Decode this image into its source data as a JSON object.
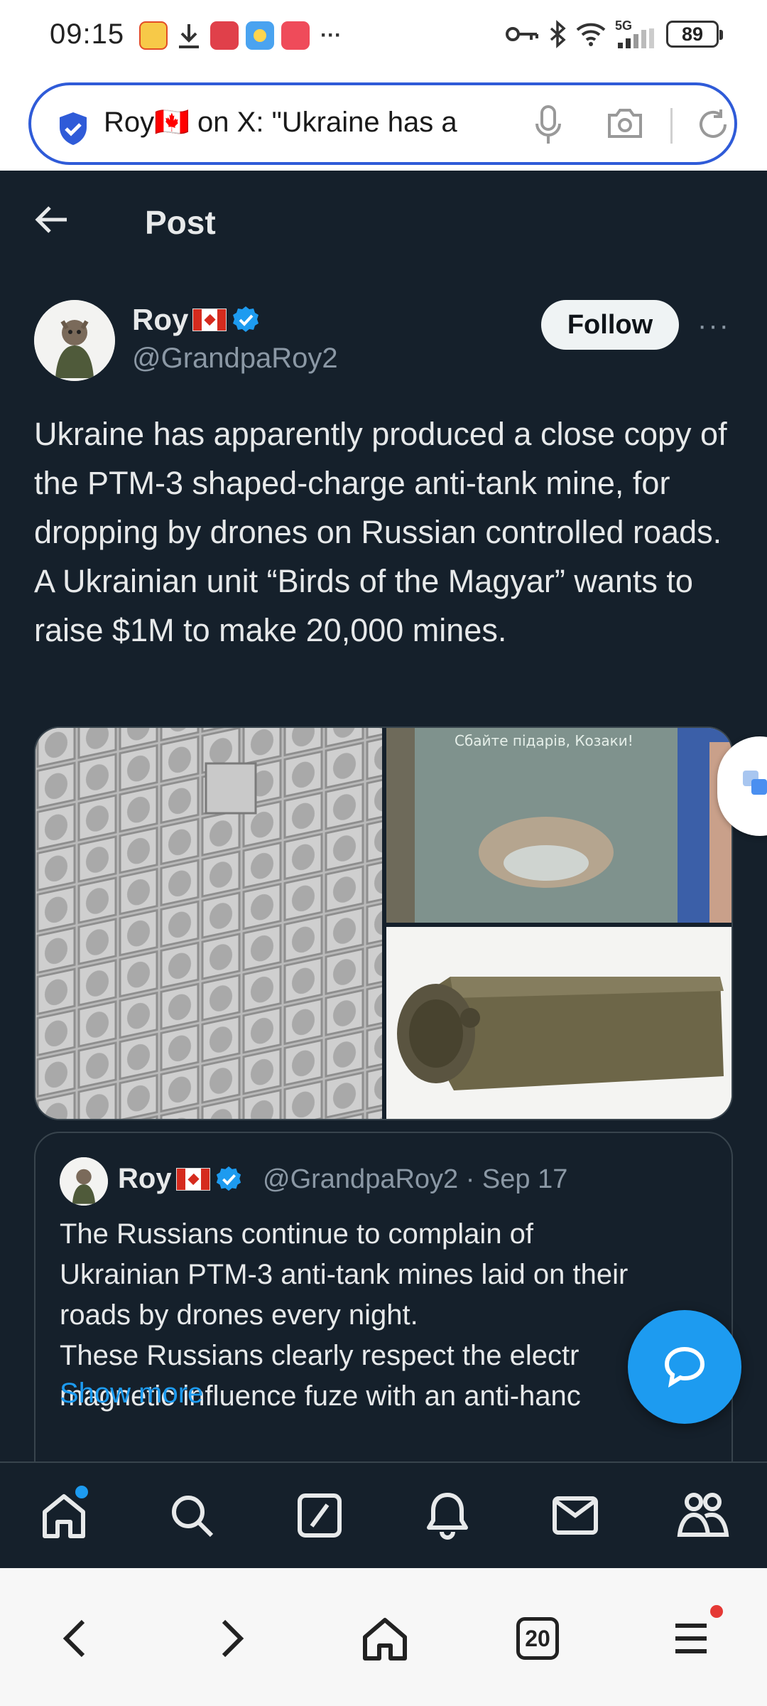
{
  "status_bar": {
    "time": "09:15",
    "notification_icons": [
      "weibo-icon",
      "download-icon",
      "huawei-icon",
      "weather-icon",
      "game-icon"
    ],
    "more": "···",
    "network_label": "5G",
    "battery": "89"
  },
  "browser": {
    "url_text": "Roy🇨🇦 on X: \"Ukraine has a",
    "tabs_count": "20"
  },
  "header": {
    "title": "Post"
  },
  "tweet": {
    "display_name": "Roy",
    "handle": "@GrandpaRoy2",
    "follow_label": "Follow",
    "more": "···",
    "text_lines": [
      "Ukraine has apparently produced a close copy of the PTM-3 shaped-charge anti-tank mine, for dropping by drones on Russian controlled roads.",
      "A Ukrainian unit “Birds of the Magyar” wants to raise $1M to make 20,000 mines."
    ],
    "image_caption": "Сбайте підарів, Козаки!"
  },
  "quote": {
    "display_name": "Roy",
    "handle_date": "@GrandpaRoy2 · Sep 17",
    "lines": [
      "The Russians continue to complain of",
      "Ukrainian PTM-3 anti-tank mines laid on their",
      "roads by drones every night.",
      "These Russians clearly respect the electr",
      "magnetic influence fuze with an anti-hanc"
    ],
    "show_more": "Show more"
  },
  "colors": {
    "background": "#15202b",
    "accent": "#1d9bf0",
    "text_primary": "#e7e9ea",
    "text_secondary": "#8b98a5",
    "border": "#38444d"
  }
}
